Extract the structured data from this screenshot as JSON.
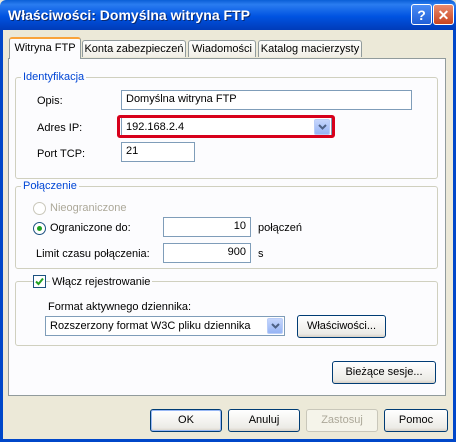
{
  "window": {
    "title": "Właściwości: Domyślna witryna FTP"
  },
  "tabs": [
    {
      "label": "Witryna FTP",
      "active": true
    },
    {
      "label": "Konta zabezpieczeń",
      "active": false
    },
    {
      "label": "Wiadomości",
      "active": false
    },
    {
      "label": "Katalog macierzysty",
      "active": false
    }
  ],
  "identification": {
    "legend": "Identyfikacja",
    "description_label": "Opis:",
    "description_value": "Domyślna witryna FTP",
    "ip_label": "Adres IP:",
    "ip_value": "192.168.2.4",
    "port_label": "Port TCP:",
    "port_value": "21"
  },
  "connection": {
    "legend": "Połączenie",
    "unlimited_label": "Nieograniczone",
    "limited_label": "Ograniczone do:",
    "limited_value": "10",
    "limited_unit": "połączeń",
    "timeout_label": "Limit czasu połączenia:",
    "timeout_value": "900",
    "timeout_unit": "s"
  },
  "logging": {
    "enable_label": "Włącz rejestrowanie",
    "enabled": true,
    "format_label": "Format aktywnego dziennika:",
    "format_value": "Rozszerzony format W3C pliku dziennika",
    "properties_button": "Właściwości..."
  },
  "current_sessions_button": "Bieżące sesje...",
  "buttons": {
    "ok": "OK",
    "cancel": "Anuluj",
    "apply": "Zastosuj",
    "help": "Pomoc"
  },
  "colors": {
    "title_bar": "#0053e1",
    "highlight_border": "#d7001b",
    "group_legend": "#0046d5"
  }
}
